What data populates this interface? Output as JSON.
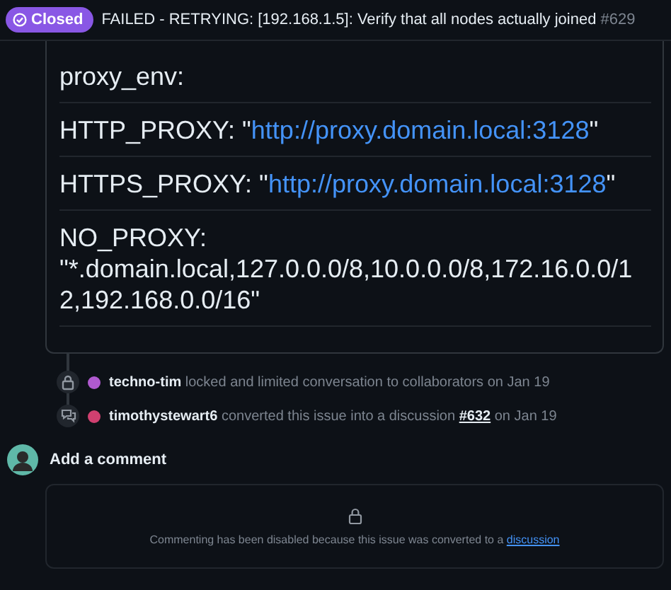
{
  "header": {
    "status": "Closed",
    "title": "FAILED - RETRYING: [192.168.1.5]: Verify that all nodes actually joined",
    "number": "#629"
  },
  "body": [
    {
      "text": "proxy_env:"
    },
    {
      "text": "HTTP_PROXY: \"",
      "link": "http://proxy.domain.local:3128",
      "after": "\""
    },
    {
      "text": "HTTPS_PROXY: \"",
      "link": "http://proxy.domain.local:3128",
      "after": "\""
    },
    {
      "text": "NO_PROXY:",
      "value": "\"*.domain.local,127.0.0.0/8,10.0.0.0/8,172.16.0.0/12,192.168.0.0/16\""
    }
  ],
  "events": [
    {
      "kind": "lock",
      "user": "techno-tim",
      "action": "locked and limited conversation to collaborators on Jan 19"
    },
    {
      "kind": "discussion",
      "user": "timothystewart6",
      "action": "converted this issue into a discussion",
      "link": "#632",
      "after": "on Jan 19"
    }
  ],
  "comment": {
    "title": "Add a comment",
    "message": "Commenting has been disabled because this issue was converted to a",
    "link": "discussion"
  }
}
